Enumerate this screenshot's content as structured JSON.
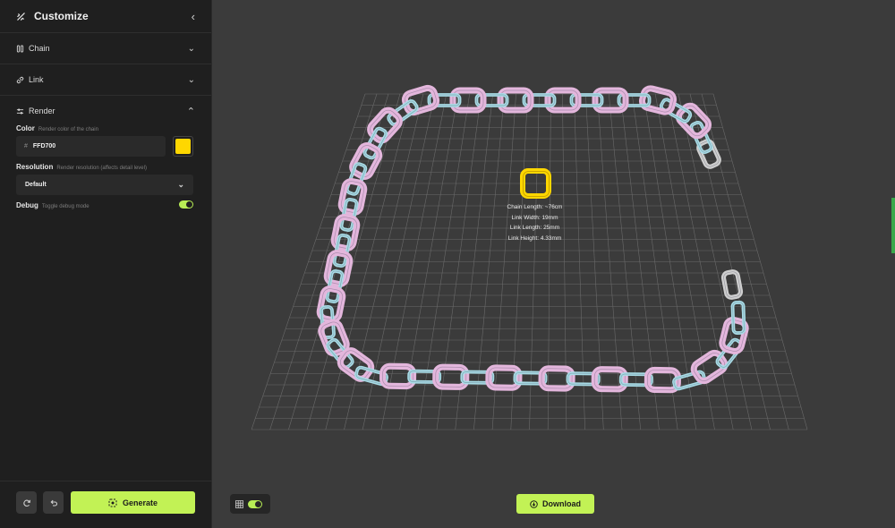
{
  "sidebar": {
    "title": "Customize",
    "collapse_icon": "chevron-left-icon",
    "sections": [
      {
        "label": "Chain",
        "icon": "chain-icon",
        "chevron": "chevron-down-icon"
      },
      {
        "label": "Link",
        "icon": "link-icon",
        "chevron": "chevron-down-icon"
      },
      {
        "label": "Render",
        "icon": "sliders-icon",
        "chevron": "chevron-up-icon"
      }
    ],
    "render": {
      "color_label": "Color",
      "color_hint": "Render color of the chain",
      "color_hash": "#",
      "color_value": "FFD700",
      "color_swatch": "#FFD700",
      "resolution_label": "Resolution",
      "resolution_hint": "Render resolution (affects detail level)",
      "resolution_value": "Default",
      "debug_label": "Debug",
      "debug_hint": "Toggle debug mode",
      "debug_on": true
    },
    "footer": {
      "reset_icon": "reset-icon",
      "undo_icon": "undo-icon",
      "generate_label": "Generate",
      "generate_icon": "sparkle-icon"
    }
  },
  "viewport": {
    "info": {
      "chain_length": "Chain Length: ~76cm",
      "link_width": "Link Width: 19mm",
      "link_length": "Link Length: 25mm",
      "link_height": "Link Height: 4.33mm"
    },
    "grid_icon": "grid-icon",
    "grid_on": true,
    "download_label": "Download",
    "download_icon": "download-icon"
  },
  "colors": {
    "accent": "#C2F255",
    "link_pink": "#E3B6DC",
    "link_blue": "#A8DCE6",
    "clasp_gray": "#CFCFCF",
    "preview_gold": "#FFD700",
    "sidebar_bg": "#1F1F1F",
    "viewport_bg": "#3B3B3B"
  }
}
